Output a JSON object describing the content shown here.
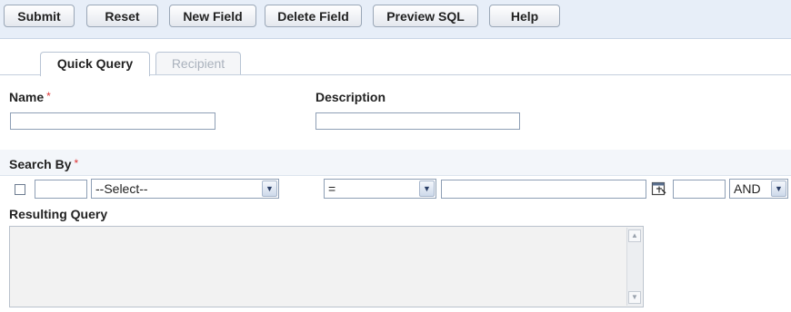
{
  "toolbar": {
    "submit": "Submit",
    "reset": "Reset",
    "new_field": "New Field",
    "delete_field": "Delete Field",
    "preview_sql": "Preview SQL",
    "help": "Help"
  },
  "tabs": [
    {
      "label": "Quick Query",
      "active": true
    },
    {
      "label": "Recipient",
      "active": false
    }
  ],
  "form": {
    "name_label": "Name",
    "required_marker": "*",
    "name_value": "",
    "description_label": "Description",
    "description_value": ""
  },
  "search_by": {
    "label": "Search By",
    "required_marker": "*",
    "row": {
      "checked": false,
      "seq_value": "",
      "field_select": "--Select--",
      "operator_select": "=",
      "value": "",
      "picker_icon": "lookup-icon",
      "extra_value": "",
      "conjunction_select": "AND"
    }
  },
  "resulting_query": {
    "label": "Resulting Query",
    "value": ""
  }
}
